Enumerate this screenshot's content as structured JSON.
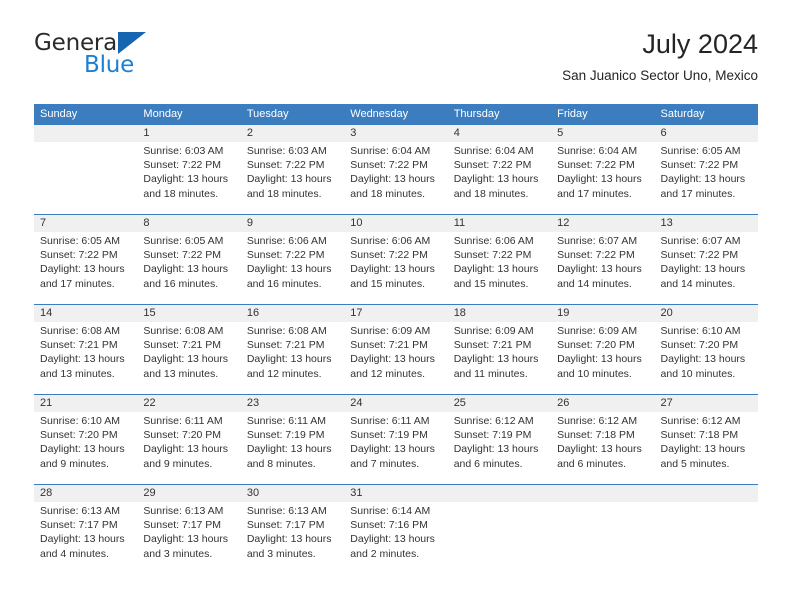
{
  "brand": {
    "name_part1": "General",
    "name_part2": "Blue",
    "logo_icon": "triangle-flag-icon"
  },
  "header": {
    "title": "July 2024",
    "subtitle": "San Juanico Sector Uno, Mexico"
  },
  "theme": {
    "header_blue": "#3b7dbf",
    "logo_blue": "#1565b0",
    "brand_blue": "#1b7fd4",
    "num_band_gray": "#f0f0f0",
    "text": "#333333"
  },
  "calendar": {
    "day_headers": [
      "Sunday",
      "Monday",
      "Tuesday",
      "Wednesday",
      "Thursday",
      "Friday",
      "Saturday"
    ],
    "weeks": [
      [
        {
          "day": "",
          "lines": []
        },
        {
          "day": "1",
          "lines": [
            "Sunrise: 6:03 AM",
            "Sunset: 7:22 PM",
            "Daylight: 13 hours",
            "and 18 minutes."
          ]
        },
        {
          "day": "2",
          "lines": [
            "Sunrise: 6:03 AM",
            "Sunset: 7:22 PM",
            "Daylight: 13 hours",
            "and 18 minutes."
          ]
        },
        {
          "day": "3",
          "lines": [
            "Sunrise: 6:04 AM",
            "Sunset: 7:22 PM",
            "Daylight: 13 hours",
            "and 18 minutes."
          ]
        },
        {
          "day": "4",
          "lines": [
            "Sunrise: 6:04 AM",
            "Sunset: 7:22 PM",
            "Daylight: 13 hours",
            "and 18 minutes."
          ]
        },
        {
          "day": "5",
          "lines": [
            "Sunrise: 6:04 AM",
            "Sunset: 7:22 PM",
            "Daylight: 13 hours",
            "and 17 minutes."
          ]
        },
        {
          "day": "6",
          "lines": [
            "Sunrise: 6:05 AM",
            "Sunset: 7:22 PM",
            "Daylight: 13 hours",
            "and 17 minutes."
          ]
        }
      ],
      [
        {
          "day": "7",
          "lines": [
            "Sunrise: 6:05 AM",
            "Sunset: 7:22 PM",
            "Daylight: 13 hours",
            "and 17 minutes."
          ]
        },
        {
          "day": "8",
          "lines": [
            "Sunrise: 6:05 AM",
            "Sunset: 7:22 PM",
            "Daylight: 13 hours",
            "and 16 minutes."
          ]
        },
        {
          "day": "9",
          "lines": [
            "Sunrise: 6:06 AM",
            "Sunset: 7:22 PM",
            "Daylight: 13 hours",
            "and 16 minutes."
          ]
        },
        {
          "day": "10",
          "lines": [
            "Sunrise: 6:06 AM",
            "Sunset: 7:22 PM",
            "Daylight: 13 hours",
            "and 15 minutes."
          ]
        },
        {
          "day": "11",
          "lines": [
            "Sunrise: 6:06 AM",
            "Sunset: 7:22 PM",
            "Daylight: 13 hours",
            "and 15 minutes."
          ]
        },
        {
          "day": "12",
          "lines": [
            "Sunrise: 6:07 AM",
            "Sunset: 7:22 PM",
            "Daylight: 13 hours",
            "and 14 minutes."
          ]
        },
        {
          "day": "13",
          "lines": [
            "Sunrise: 6:07 AM",
            "Sunset: 7:22 PM",
            "Daylight: 13 hours",
            "and 14 minutes."
          ]
        }
      ],
      [
        {
          "day": "14",
          "lines": [
            "Sunrise: 6:08 AM",
            "Sunset: 7:21 PM",
            "Daylight: 13 hours",
            "and 13 minutes."
          ]
        },
        {
          "day": "15",
          "lines": [
            "Sunrise: 6:08 AM",
            "Sunset: 7:21 PM",
            "Daylight: 13 hours",
            "and 13 minutes."
          ]
        },
        {
          "day": "16",
          "lines": [
            "Sunrise: 6:08 AM",
            "Sunset: 7:21 PM",
            "Daylight: 13 hours",
            "and 12 minutes."
          ]
        },
        {
          "day": "17",
          "lines": [
            "Sunrise: 6:09 AM",
            "Sunset: 7:21 PM",
            "Daylight: 13 hours",
            "and 12 minutes."
          ]
        },
        {
          "day": "18",
          "lines": [
            "Sunrise: 6:09 AM",
            "Sunset: 7:21 PM",
            "Daylight: 13 hours",
            "and 11 minutes."
          ]
        },
        {
          "day": "19",
          "lines": [
            "Sunrise: 6:09 AM",
            "Sunset: 7:20 PM",
            "Daylight: 13 hours",
            "and 10 minutes."
          ]
        },
        {
          "day": "20",
          "lines": [
            "Sunrise: 6:10 AM",
            "Sunset: 7:20 PM",
            "Daylight: 13 hours",
            "and 10 minutes."
          ]
        }
      ],
      [
        {
          "day": "21",
          "lines": [
            "Sunrise: 6:10 AM",
            "Sunset: 7:20 PM",
            "Daylight: 13 hours",
            "and 9 minutes."
          ]
        },
        {
          "day": "22",
          "lines": [
            "Sunrise: 6:11 AM",
            "Sunset: 7:20 PM",
            "Daylight: 13 hours",
            "and 9 minutes."
          ]
        },
        {
          "day": "23",
          "lines": [
            "Sunrise: 6:11 AM",
            "Sunset: 7:19 PM",
            "Daylight: 13 hours",
            "and 8 minutes."
          ]
        },
        {
          "day": "24",
          "lines": [
            "Sunrise: 6:11 AM",
            "Sunset: 7:19 PM",
            "Daylight: 13 hours",
            "and 7 minutes."
          ]
        },
        {
          "day": "25",
          "lines": [
            "Sunrise: 6:12 AM",
            "Sunset: 7:19 PM",
            "Daylight: 13 hours",
            "and 6 minutes."
          ]
        },
        {
          "day": "26",
          "lines": [
            "Sunrise: 6:12 AM",
            "Sunset: 7:18 PM",
            "Daylight: 13 hours",
            "and 6 minutes."
          ]
        },
        {
          "day": "27",
          "lines": [
            "Sunrise: 6:12 AM",
            "Sunset: 7:18 PM",
            "Daylight: 13 hours",
            "and 5 minutes."
          ]
        }
      ],
      [
        {
          "day": "28",
          "lines": [
            "Sunrise: 6:13 AM",
            "Sunset: 7:17 PM",
            "Daylight: 13 hours",
            "and 4 minutes."
          ]
        },
        {
          "day": "29",
          "lines": [
            "Sunrise: 6:13 AM",
            "Sunset: 7:17 PM",
            "Daylight: 13 hours",
            "and 3 minutes."
          ]
        },
        {
          "day": "30",
          "lines": [
            "Sunrise: 6:13 AM",
            "Sunset: 7:17 PM",
            "Daylight: 13 hours",
            "and 3 minutes."
          ]
        },
        {
          "day": "31",
          "lines": [
            "Sunrise: 6:14 AM",
            "Sunset: 7:16 PM",
            "Daylight: 13 hours",
            "and 2 minutes."
          ]
        },
        {
          "day": "",
          "lines": []
        },
        {
          "day": "",
          "lines": []
        },
        {
          "day": "",
          "lines": []
        }
      ]
    ]
  }
}
